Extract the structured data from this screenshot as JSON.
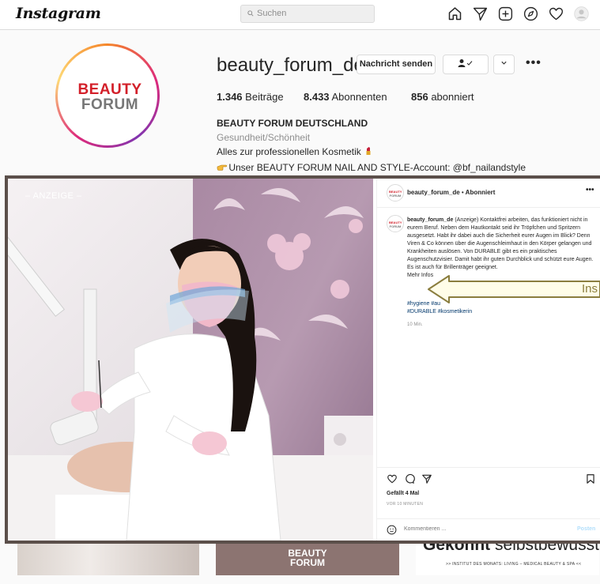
{
  "nav": {
    "logo": "Instagram",
    "search_placeholder": "Suchen",
    "icons": [
      "home-icon",
      "direct-icon",
      "new-post-icon",
      "explore-icon",
      "activity-heart-icon",
      "profile-avatar-icon"
    ]
  },
  "profile": {
    "avatar_line1": "BEAUTY",
    "avatar_line2": "FORUM",
    "username": "beauty_forum_de",
    "message_button": "Nachricht senden",
    "posts_count": "1.346",
    "posts_label": "Beiträge",
    "followers_count": "8.433",
    "followers_label": "Abonnenten",
    "following_count": "856",
    "following_label": "abonniert",
    "full_name": "BEAUTY FORUM DEUTSCHLAND",
    "category": "Gesundheit/Schönheit",
    "bio_line1": "Alles zur professionellen Kosmetik",
    "bio_line2": "Unser BEAUTY FORUM NAIL AND STYLE-Account: @bf_nailandstyle"
  },
  "grid": {
    "cell2_line1": "BEAUTY",
    "cell2_line2": "FORUM",
    "cell3_headline_bold": "Gekonnt",
    "cell3_headline_rest": "selbstbewusst",
    "cell3_sub": ">> INSTITUT DES MONATS: LIVING – MEDICAL BEAUTY & SPA <<"
  },
  "post": {
    "ad_label": "– ANZEIGE –",
    "author": "beauty_forum_de",
    "follow_state": "Abonniert",
    "caption_author": "beauty_forum_de",
    "caption_text": "(Anzeige) Kontaktfrei arbeiten, das funktioniert nicht in eurem Beruf. Neben dem Hautkontakt seid ihr Tröpfchen und Spritzern ausgesetzt. Habt ihr dabei auch die Sicherheit eurer Augen im Blick? Denn Viren & Co können über die Augenschleimhaut in den Körper gelangen und Krankheiten auslösen. Von DURABLE gibt es ein praktisches Augenschutzvisier. Damit habt ihr guten Durchblick und schützt eure Augen. Es ist auch für Brillenträger geeignet.",
    "more_info": "Mehr Infos",
    "hashtags_line1": "#hygiene #au",
    "hashtags_line2": "#DURABLE #kosmetikerin",
    "time": "10 Min.",
    "likes": "Gefällt 4 Mal",
    "ago": "VOR 10 MINUTEN",
    "comment_placeholder": "Kommentieren ...",
    "post_button": "Posten",
    "callout_text": "Ins"
  },
  "colors": {
    "modal_border": "#5b4f4a",
    "link": "#00376b",
    "brand_red": "#d3202a",
    "callout": "#8a7d3e"
  }
}
